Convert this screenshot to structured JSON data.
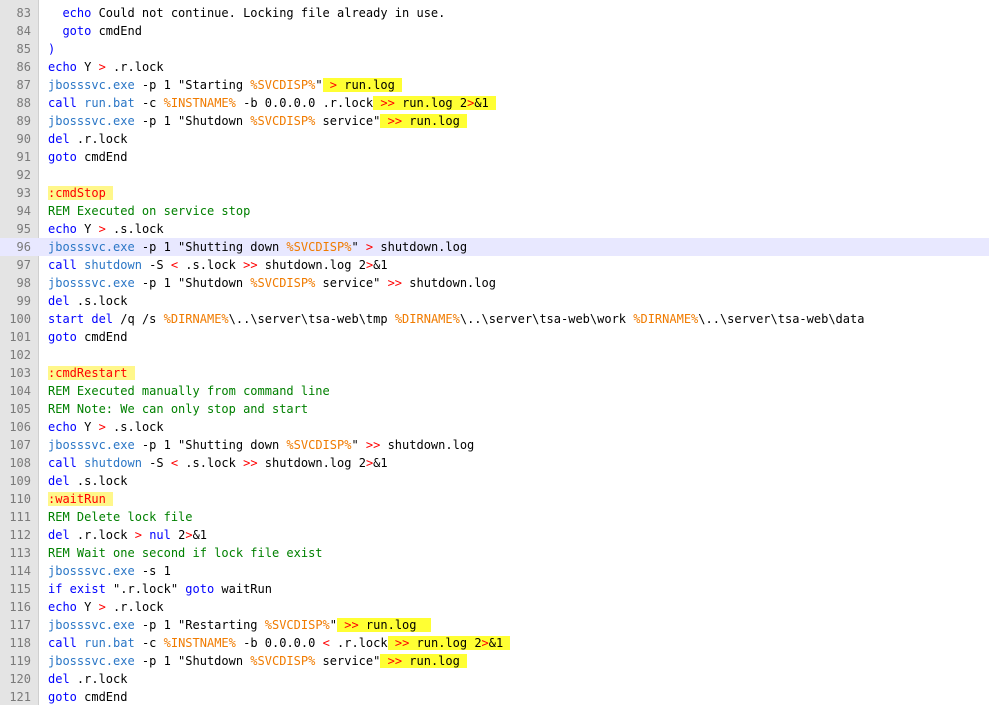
{
  "editor": {
    "lines": [
      {
        "n": "83",
        "s": [
          {
            "t": "tx",
            "v": "  "
          },
          {
            "t": "kw",
            "v": "echo"
          },
          {
            "t": "tx",
            "v": " Could not continue. Locking file already in use."
          }
        ]
      },
      {
        "n": "84",
        "s": [
          {
            "t": "tx",
            "v": "  "
          },
          {
            "t": "kw",
            "v": "goto"
          },
          {
            "t": "tx",
            "v": " cmdEnd"
          }
        ]
      },
      {
        "n": "85",
        "s": [
          {
            "t": "kw",
            "v": ")"
          }
        ]
      },
      {
        "n": "86",
        "s": [
          {
            "t": "kw",
            "v": "echo"
          },
          {
            "t": "tx",
            "v": " Y "
          },
          {
            "t": "op",
            "v": ">"
          },
          {
            "t": "tx",
            "v": " .r.lock"
          }
        ]
      },
      {
        "n": "87",
        "s": [
          {
            "t": "exe",
            "v": "jbosssvc.exe"
          },
          {
            "t": "tx",
            "v": " -p 1 \"Starting "
          },
          {
            "t": "var",
            "v": "%SVCDISP%"
          },
          {
            "t": "tx",
            "v": "\""
          },
          {
            "t": "hl",
            "v": [
              {
                "t": "tx",
                "v": " "
              },
              {
                "t": "op",
                "v": ">"
              },
              {
                "t": "tx",
                "v": " run.log "
              }
            ]
          }
        ]
      },
      {
        "n": "88",
        "s": [
          {
            "t": "kw",
            "v": "call"
          },
          {
            "t": "tx",
            "v": " "
          },
          {
            "t": "exe",
            "v": "run.bat"
          },
          {
            "t": "tx",
            "v": " -c "
          },
          {
            "t": "var",
            "v": "%INSTNAME%"
          },
          {
            "t": "tx",
            "v": " -b 0.0.0.0 .r.lock"
          },
          {
            "t": "hl",
            "v": [
              {
                "t": "tx",
                "v": " "
              },
              {
                "t": "op",
                "v": ">>"
              },
              {
                "t": "tx",
                "v": " run.log 2"
              },
              {
                "t": "op",
                "v": ">"
              },
              {
                "t": "tx",
                "v": "&1 "
              }
            ]
          }
        ]
      },
      {
        "n": "89",
        "s": [
          {
            "t": "exe",
            "v": "jbosssvc.exe"
          },
          {
            "t": "tx",
            "v": " -p 1 \"Shutdown "
          },
          {
            "t": "var",
            "v": "%SVCDISP%"
          },
          {
            "t": "tx",
            "v": " service\""
          },
          {
            "t": "hl",
            "v": [
              {
                "t": "tx",
                "v": " "
              },
              {
                "t": "op",
                "v": ">>"
              },
              {
                "t": "tx",
                "v": " run.log "
              }
            ]
          }
        ]
      },
      {
        "n": "90",
        "s": [
          {
            "t": "kw",
            "v": "del"
          },
          {
            "t": "tx",
            "v": " .r.lock"
          }
        ]
      },
      {
        "n": "91",
        "s": [
          {
            "t": "kw",
            "v": "goto"
          },
          {
            "t": "tx",
            "v": " cmdEnd"
          }
        ]
      },
      {
        "n": "92",
        "s": []
      },
      {
        "n": "93",
        "s": [
          {
            "t": "lbl",
            "v": ":cmdStop "
          }
        ]
      },
      {
        "n": "94",
        "s": [
          {
            "t": "cm",
            "v": "REM Executed on service stop"
          }
        ]
      },
      {
        "n": "95",
        "s": [
          {
            "t": "kw",
            "v": "echo"
          },
          {
            "t": "tx",
            "v": " Y "
          },
          {
            "t": "op",
            "v": ">"
          },
          {
            "t": "tx",
            "v": " .s.lock"
          }
        ]
      },
      {
        "n": "96",
        "current": true,
        "s": [
          {
            "t": "exe",
            "v": "jbosssvc.exe"
          },
          {
            "t": "tx",
            "v": " -p 1 \"Shutting down "
          },
          {
            "t": "var",
            "v": "%SVCDISP%"
          },
          {
            "t": "tx",
            "v": "\" "
          },
          {
            "t": "op",
            "v": ">"
          },
          {
            "t": "tx",
            "v": " shutdown.log"
          }
        ]
      },
      {
        "n": "97",
        "s": [
          {
            "t": "kw",
            "v": "call"
          },
          {
            "t": "tx",
            "v": " "
          },
          {
            "t": "exe",
            "v": "shutdown"
          },
          {
            "t": "tx",
            "v": " -S "
          },
          {
            "t": "op",
            "v": "<"
          },
          {
            "t": "tx",
            "v": " .s.lock "
          },
          {
            "t": "op",
            "v": ">>"
          },
          {
            "t": "tx",
            "v": " shutdown.log 2"
          },
          {
            "t": "op",
            "v": ">"
          },
          {
            "t": "tx",
            "v": "&1"
          }
        ]
      },
      {
        "n": "98",
        "s": [
          {
            "t": "exe",
            "v": "jbosssvc.exe"
          },
          {
            "t": "tx",
            "v": " -p 1 \"Shutdown "
          },
          {
            "t": "var",
            "v": "%SVCDISP%"
          },
          {
            "t": "tx",
            "v": " service\" "
          },
          {
            "t": "op",
            "v": ">>"
          },
          {
            "t": "tx",
            "v": " shutdown.log"
          }
        ]
      },
      {
        "n": "99",
        "s": [
          {
            "t": "kw",
            "v": "del"
          },
          {
            "t": "tx",
            "v": " .s.lock"
          }
        ]
      },
      {
        "n": "100",
        "s": [
          {
            "t": "kw",
            "v": "start"
          },
          {
            "t": "tx",
            "v": " "
          },
          {
            "t": "kw",
            "v": "del"
          },
          {
            "t": "tx",
            "v": " /q /s "
          },
          {
            "t": "var",
            "v": "%DIRNAME%"
          },
          {
            "t": "tx",
            "v": "\\..\\server\\tsa-web\\tmp "
          },
          {
            "t": "var",
            "v": "%DIRNAME%"
          },
          {
            "t": "tx",
            "v": "\\..\\server\\tsa-web\\work "
          },
          {
            "t": "var",
            "v": "%DIRNAME%"
          },
          {
            "t": "tx",
            "v": "\\..\\server\\tsa-web\\data"
          }
        ]
      },
      {
        "n": "101",
        "s": [
          {
            "t": "kw",
            "v": "goto"
          },
          {
            "t": "tx",
            "v": " cmdEnd"
          }
        ]
      },
      {
        "n": "102",
        "s": []
      },
      {
        "n": "103",
        "s": [
          {
            "t": "lbl",
            "v": ":cmdRestart "
          }
        ]
      },
      {
        "n": "104",
        "s": [
          {
            "t": "cm",
            "v": "REM Executed manually from command line"
          }
        ]
      },
      {
        "n": "105",
        "s": [
          {
            "t": "cm",
            "v": "REM Note: We can only stop and start"
          }
        ]
      },
      {
        "n": "106",
        "s": [
          {
            "t": "kw",
            "v": "echo"
          },
          {
            "t": "tx",
            "v": " Y "
          },
          {
            "t": "op",
            "v": ">"
          },
          {
            "t": "tx",
            "v": " .s.lock"
          }
        ]
      },
      {
        "n": "107",
        "s": [
          {
            "t": "exe",
            "v": "jbosssvc.exe"
          },
          {
            "t": "tx",
            "v": " -p 1 \"Shutting down "
          },
          {
            "t": "var",
            "v": "%SVCDISP%"
          },
          {
            "t": "tx",
            "v": "\" "
          },
          {
            "t": "op",
            "v": ">>"
          },
          {
            "t": "tx",
            "v": " shutdown.log"
          }
        ]
      },
      {
        "n": "108",
        "s": [
          {
            "t": "kw",
            "v": "call"
          },
          {
            "t": "tx",
            "v": " "
          },
          {
            "t": "exe",
            "v": "shutdown"
          },
          {
            "t": "tx",
            "v": " -S "
          },
          {
            "t": "op",
            "v": "<"
          },
          {
            "t": "tx",
            "v": " .s.lock "
          },
          {
            "t": "op",
            "v": ">>"
          },
          {
            "t": "tx",
            "v": " shutdown.log 2"
          },
          {
            "t": "op",
            "v": ">"
          },
          {
            "t": "tx",
            "v": "&1"
          }
        ]
      },
      {
        "n": "109",
        "s": [
          {
            "t": "kw",
            "v": "del"
          },
          {
            "t": "tx",
            "v": " .s.lock"
          }
        ]
      },
      {
        "n": "110",
        "s": [
          {
            "t": "lbl",
            "v": ":waitRun "
          }
        ]
      },
      {
        "n": "111",
        "s": [
          {
            "t": "cm",
            "v": "REM Delete lock file"
          }
        ]
      },
      {
        "n": "112",
        "s": [
          {
            "t": "kw",
            "v": "del"
          },
          {
            "t": "tx",
            "v": " .r.lock "
          },
          {
            "t": "op",
            "v": ">"
          },
          {
            "t": "tx",
            "v": " "
          },
          {
            "t": "kw",
            "v": "nul"
          },
          {
            "t": "tx",
            "v": " 2"
          },
          {
            "t": "op",
            "v": ">"
          },
          {
            "t": "tx",
            "v": "&1"
          }
        ]
      },
      {
        "n": "113",
        "s": [
          {
            "t": "cm",
            "v": "REM Wait one second if lock file exist"
          }
        ]
      },
      {
        "n": "114",
        "s": [
          {
            "t": "exe",
            "v": "jbosssvc.exe"
          },
          {
            "t": "tx",
            "v": " -s 1"
          }
        ]
      },
      {
        "n": "115",
        "s": [
          {
            "t": "kw",
            "v": "if exist"
          },
          {
            "t": "tx",
            "v": " \".r.lock\" "
          },
          {
            "t": "kw",
            "v": "goto"
          },
          {
            "t": "tx",
            "v": " waitRun"
          }
        ]
      },
      {
        "n": "116",
        "s": [
          {
            "t": "kw",
            "v": "echo"
          },
          {
            "t": "tx",
            "v": " Y "
          },
          {
            "t": "op",
            "v": ">"
          },
          {
            "t": "tx",
            "v": " .r.lock"
          }
        ]
      },
      {
        "n": "117",
        "s": [
          {
            "t": "exe",
            "v": "jbosssvc.exe"
          },
          {
            "t": "tx",
            "v": " -p 1 \"Restarting "
          },
          {
            "t": "var",
            "v": "%SVCDISP%"
          },
          {
            "t": "tx",
            "v": "\""
          },
          {
            "t": "hl",
            "v": [
              {
                "t": "tx",
                "v": " "
              },
              {
                "t": "op",
                "v": ">>"
              },
              {
                "t": "tx",
                "v": " run.log  "
              }
            ]
          }
        ]
      },
      {
        "n": "118",
        "s": [
          {
            "t": "kw",
            "v": "call"
          },
          {
            "t": "tx",
            "v": " "
          },
          {
            "t": "exe",
            "v": "run.bat"
          },
          {
            "t": "tx",
            "v": " -c "
          },
          {
            "t": "var",
            "v": "%INSTNAME%"
          },
          {
            "t": "tx",
            "v": " -b 0.0.0.0 "
          },
          {
            "t": "op",
            "v": "<"
          },
          {
            "t": "tx",
            "v": " .r.lock"
          },
          {
            "t": "hl",
            "v": [
              {
                "t": "tx",
                "v": " "
              },
              {
                "t": "op",
                "v": ">>"
              },
              {
                "t": "tx",
                "v": " run.log 2"
              },
              {
                "t": "op",
                "v": ">"
              },
              {
                "t": "tx",
                "v": "&1 "
              }
            ]
          }
        ]
      },
      {
        "n": "119",
        "s": [
          {
            "t": "exe",
            "v": "jbosssvc.exe"
          },
          {
            "t": "tx",
            "v": " -p 1 \"Shutdown "
          },
          {
            "t": "var",
            "v": "%SVCDISP%"
          },
          {
            "t": "tx",
            "v": " service\""
          },
          {
            "t": "hl",
            "v": [
              {
                "t": "tx",
                "v": " "
              },
              {
                "t": "op",
                "v": ">>"
              },
              {
                "t": "tx",
                "v": " run.log "
              }
            ]
          }
        ]
      },
      {
        "n": "120",
        "s": [
          {
            "t": "kw",
            "v": "del"
          },
          {
            "t": "tx",
            "v": " .r.lock"
          }
        ]
      },
      {
        "n": "121",
        "s": [
          {
            "t": "kw",
            "v": "goto"
          },
          {
            "t": "tx",
            "v": " cmdEnd"
          }
        ]
      }
    ]
  },
  "colors": {
    "keyword": "#0000ff",
    "executable": "#2a76c6",
    "variable": "#f07b00",
    "operator": "#ff0000",
    "comment": "#008000",
    "label": "#ff0000",
    "highlight": "#ffff33",
    "current_line": "#e8e8ff",
    "gutter": "#e4e4e4"
  }
}
